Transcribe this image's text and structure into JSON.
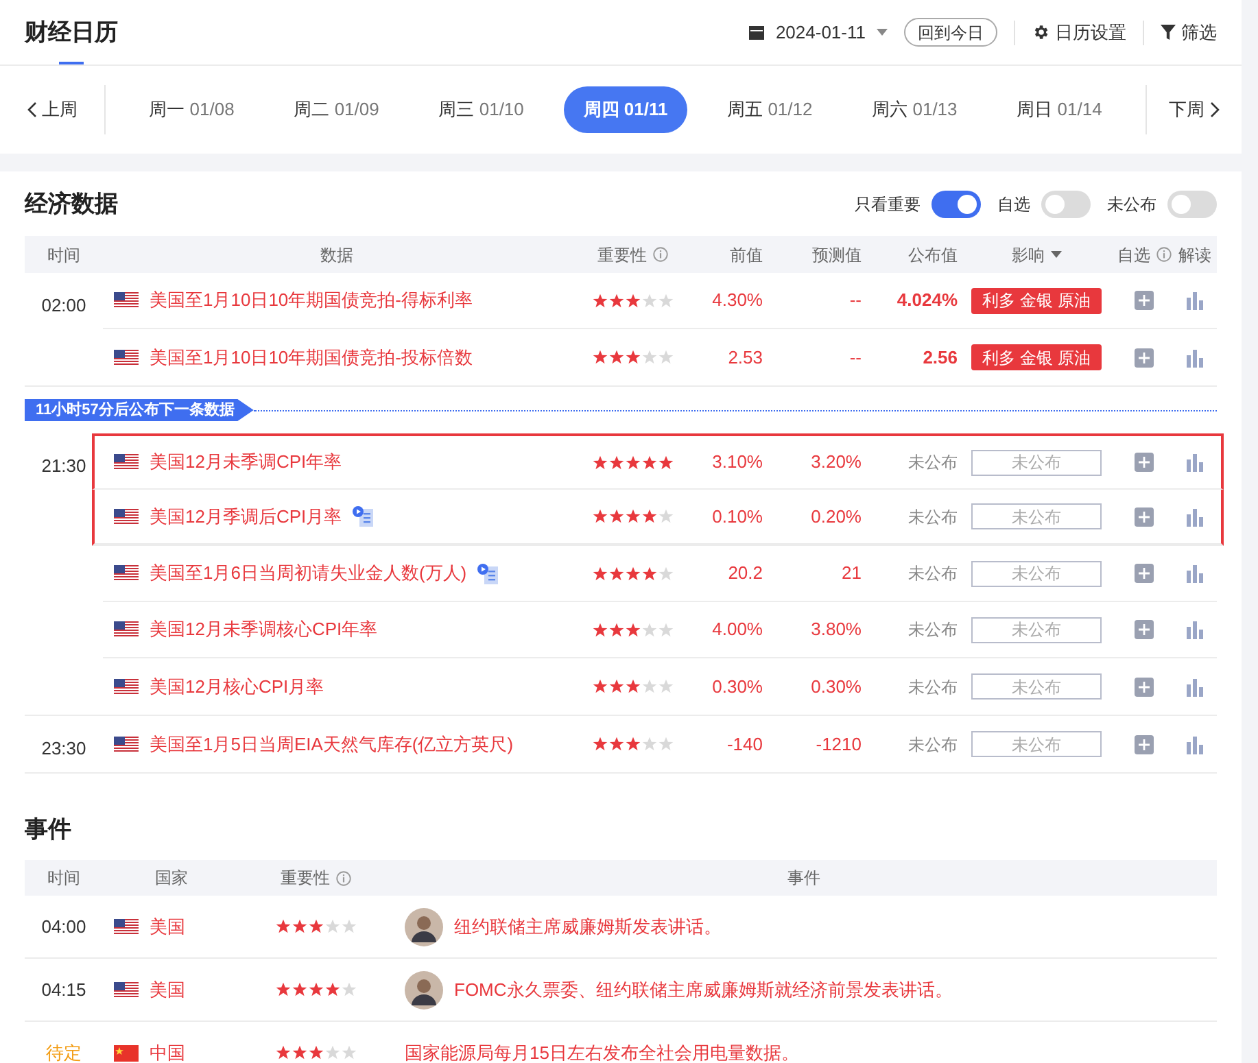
{
  "header": {
    "title": "财经日历",
    "date": "2024-01-11",
    "today_button": "回到今日",
    "settings": "日历设置",
    "filter": "筛选"
  },
  "week": {
    "prev": "上周",
    "next": "下周",
    "days": [
      {
        "day": "周一",
        "date": "01/08",
        "selected": false
      },
      {
        "day": "周二",
        "date": "01/09",
        "selected": false
      },
      {
        "day": "周三",
        "date": "01/10",
        "selected": false
      },
      {
        "day": "周四",
        "date": "01/11",
        "selected": true
      },
      {
        "day": "周五",
        "date": "01/12",
        "selected": false
      },
      {
        "day": "周六",
        "date": "01/13",
        "selected": false
      },
      {
        "day": "周日",
        "date": "01/14",
        "selected": false
      }
    ]
  },
  "economic": {
    "title": "经济数据",
    "toggles": [
      {
        "label": "只看重要",
        "on": true
      },
      {
        "label": "自选",
        "on": false
      },
      {
        "label": "未公布",
        "on": false
      }
    ],
    "columns": [
      {
        "label": "时间",
        "kind": "plain"
      },
      {
        "label": "数据",
        "kind": "plain"
      },
      {
        "label": "重要性",
        "kind": "info"
      },
      {
        "label": "前值",
        "kind": "plain"
      },
      {
        "label": "预测值",
        "kind": "plain"
      },
      {
        "label": "公布值",
        "kind": "plain"
      },
      {
        "label": "影响",
        "kind": "dropdown"
      },
      {
        "label": "自选",
        "kind": "info"
      },
      {
        "label": "解读",
        "kind": "plain"
      }
    ],
    "groups": [
      {
        "kind": "group",
        "time": "02:00",
        "rows": [
          {
            "name": "美国至1月10日10年期国债竞拍-得标利率",
            "video": false,
            "highlighted": false,
            "stars": 3,
            "previous": "4.30%",
            "forecast": "--",
            "actual": "4.024%",
            "released": true,
            "impact": "利多 金银 原油"
          },
          {
            "name": "美国至1月10日10年期国债竞拍-投标倍数",
            "video": false,
            "highlighted": false,
            "stars": 3,
            "previous": "2.53",
            "forecast": "--",
            "actual": "2.56",
            "released": true,
            "impact": "利多 金银 原油"
          }
        ]
      },
      {
        "kind": "countdown",
        "text": "11小时57分后公布下一条数据"
      },
      {
        "kind": "group",
        "time": "21:30",
        "rows": [
          {
            "name": "美国12月未季调CPI年率",
            "video": false,
            "highlighted": true,
            "stars": 5,
            "previous": "3.10%",
            "forecast": "3.20%",
            "actual": "未公布",
            "released": false,
            "impact": "未公布"
          },
          {
            "name": "美国12月季调后CPI月率",
            "video": true,
            "highlighted": true,
            "stars": 4,
            "previous": "0.10%",
            "forecast": "0.20%",
            "actual": "未公布",
            "released": false,
            "impact": "未公布"
          },
          {
            "name": "美国至1月6日当周初请失业金人数(万人)",
            "video": true,
            "highlighted": false,
            "stars": 4,
            "previous": "20.2",
            "forecast": "21",
            "actual": "未公布",
            "released": false,
            "impact": "未公布"
          },
          {
            "name": "美国12月未季调核心CPI年率",
            "video": false,
            "highlighted": false,
            "stars": 3,
            "previous": "4.00%",
            "forecast": "3.80%",
            "actual": "未公布",
            "released": false,
            "impact": "未公布"
          },
          {
            "name": "美国12月核心CPI月率",
            "video": false,
            "highlighted": false,
            "stars": 3,
            "previous": "0.30%",
            "forecast": "0.30%",
            "actual": "未公布",
            "released": false,
            "impact": "未公布"
          }
        ]
      },
      {
        "kind": "group",
        "time": "23:30",
        "rows": [
          {
            "name": "美国至1月5日当周EIA天然气库存(亿立方英尺)",
            "video": false,
            "highlighted": false,
            "stars": 3,
            "previous": "-140",
            "forecast": "-1210",
            "actual": "未公布",
            "released": false,
            "impact": "未公布"
          }
        ]
      }
    ]
  },
  "events": {
    "title": "事件",
    "columns": [
      {
        "label": "时间",
        "kind": "plain"
      },
      {
        "label": "国家",
        "kind": "plain"
      },
      {
        "label": "重要性",
        "kind": "info"
      },
      {
        "label": "事件",
        "kind": "plain"
      }
    ],
    "rows": [
      {
        "time": "04:00",
        "pending": false,
        "kind": "usa",
        "country": "美国",
        "stars": 3,
        "avatar": true,
        "event": "纽约联储主席威廉姆斯发表讲话。"
      },
      {
        "time": "04:15",
        "pending": false,
        "kind": "usa",
        "country": "美国",
        "stars": 4,
        "avatar": true,
        "event": "FOMC永久票委、纽约联储主席威廉姆斯就经济前景发表讲话。"
      },
      {
        "time": "待定",
        "pending": true,
        "kind": "china",
        "country": "中国",
        "stars": 3,
        "avatar": false,
        "event": "国家能源局每月15日左右发布全社会用电量数据。"
      }
    ]
  }
}
